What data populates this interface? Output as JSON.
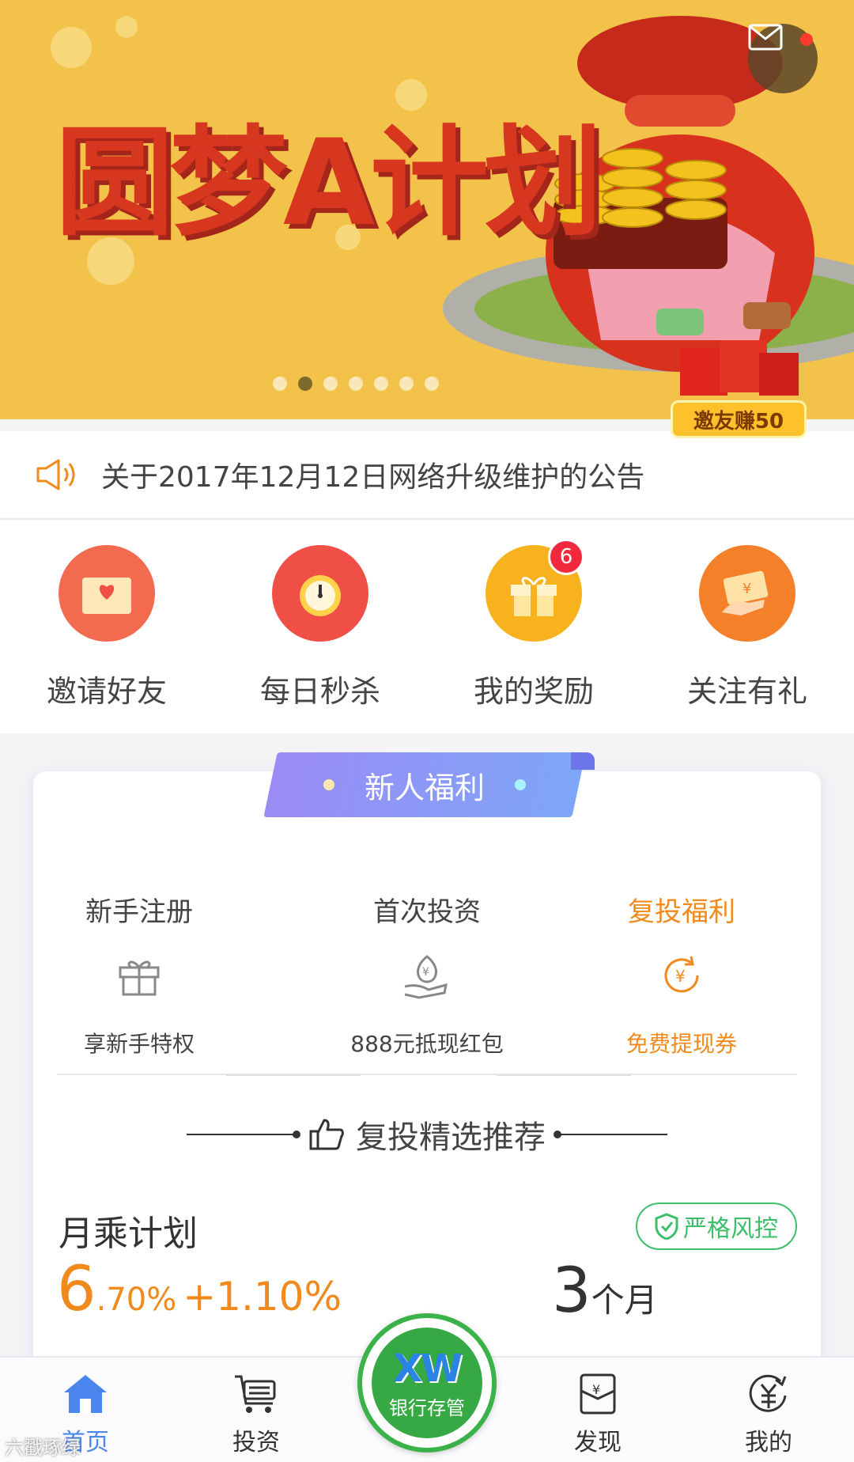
{
  "banner": {
    "title": "圆梦A计划",
    "invite_badge": "邀友赚50",
    "dots_count": 7,
    "active_dot": 1
  },
  "notice": {
    "text": "关于2017年12月12日网络升级维护的公告"
  },
  "quick": [
    {
      "label": "邀请好友",
      "icon": "envelope-heart-icon",
      "color": "#f36b4f"
    },
    {
      "label": "每日秒杀",
      "icon": "alarm-clock-icon",
      "color": "#f04f46"
    },
    {
      "label": "我的奖励",
      "icon": "gift-icon",
      "color": "#f7b21d",
      "badge": "6"
    },
    {
      "label": "关注有礼",
      "icon": "coupon-hand-icon",
      "color": "#f5802a"
    }
  ],
  "card": {
    "ribbon": "新人福利",
    "steps": [
      {
        "title": "新手注册",
        "sub": "享新手特权",
        "icon": "gift-outline-icon"
      },
      {
        "title": "首次投资",
        "sub": "888元抵现红包",
        "icon": "money-bag-hand-icon"
      },
      {
        "title": "复投福利",
        "sub": "免费提现券",
        "icon": "yuan-refresh-icon"
      }
    ],
    "recommend": "复投精选推荐",
    "product": {
      "name": "月乘计划",
      "risk_tag": "严格风控",
      "rate_int": "6",
      "rate_dec": ".70%",
      "rate_extra": "+1.10%",
      "term_num": "3",
      "term_unit": "个月"
    }
  },
  "tabbar": {
    "tabs": [
      {
        "label": "首页",
        "icon": "home-icon"
      },
      {
        "label": "投资",
        "icon": "cart-icon"
      },
      {
        "label": "发现",
        "icon": "yuan-bag-icon"
      },
      {
        "label": "我的",
        "icon": "yuan-circle-icon"
      }
    ],
    "center": {
      "logo": "XW",
      "sub": "银行存管"
    },
    "watermark": "六戳琢绿"
  },
  "colors": {
    "accent": "#f08a1c",
    "blue": "#4b86ee",
    "green": "#3dbf6a"
  }
}
